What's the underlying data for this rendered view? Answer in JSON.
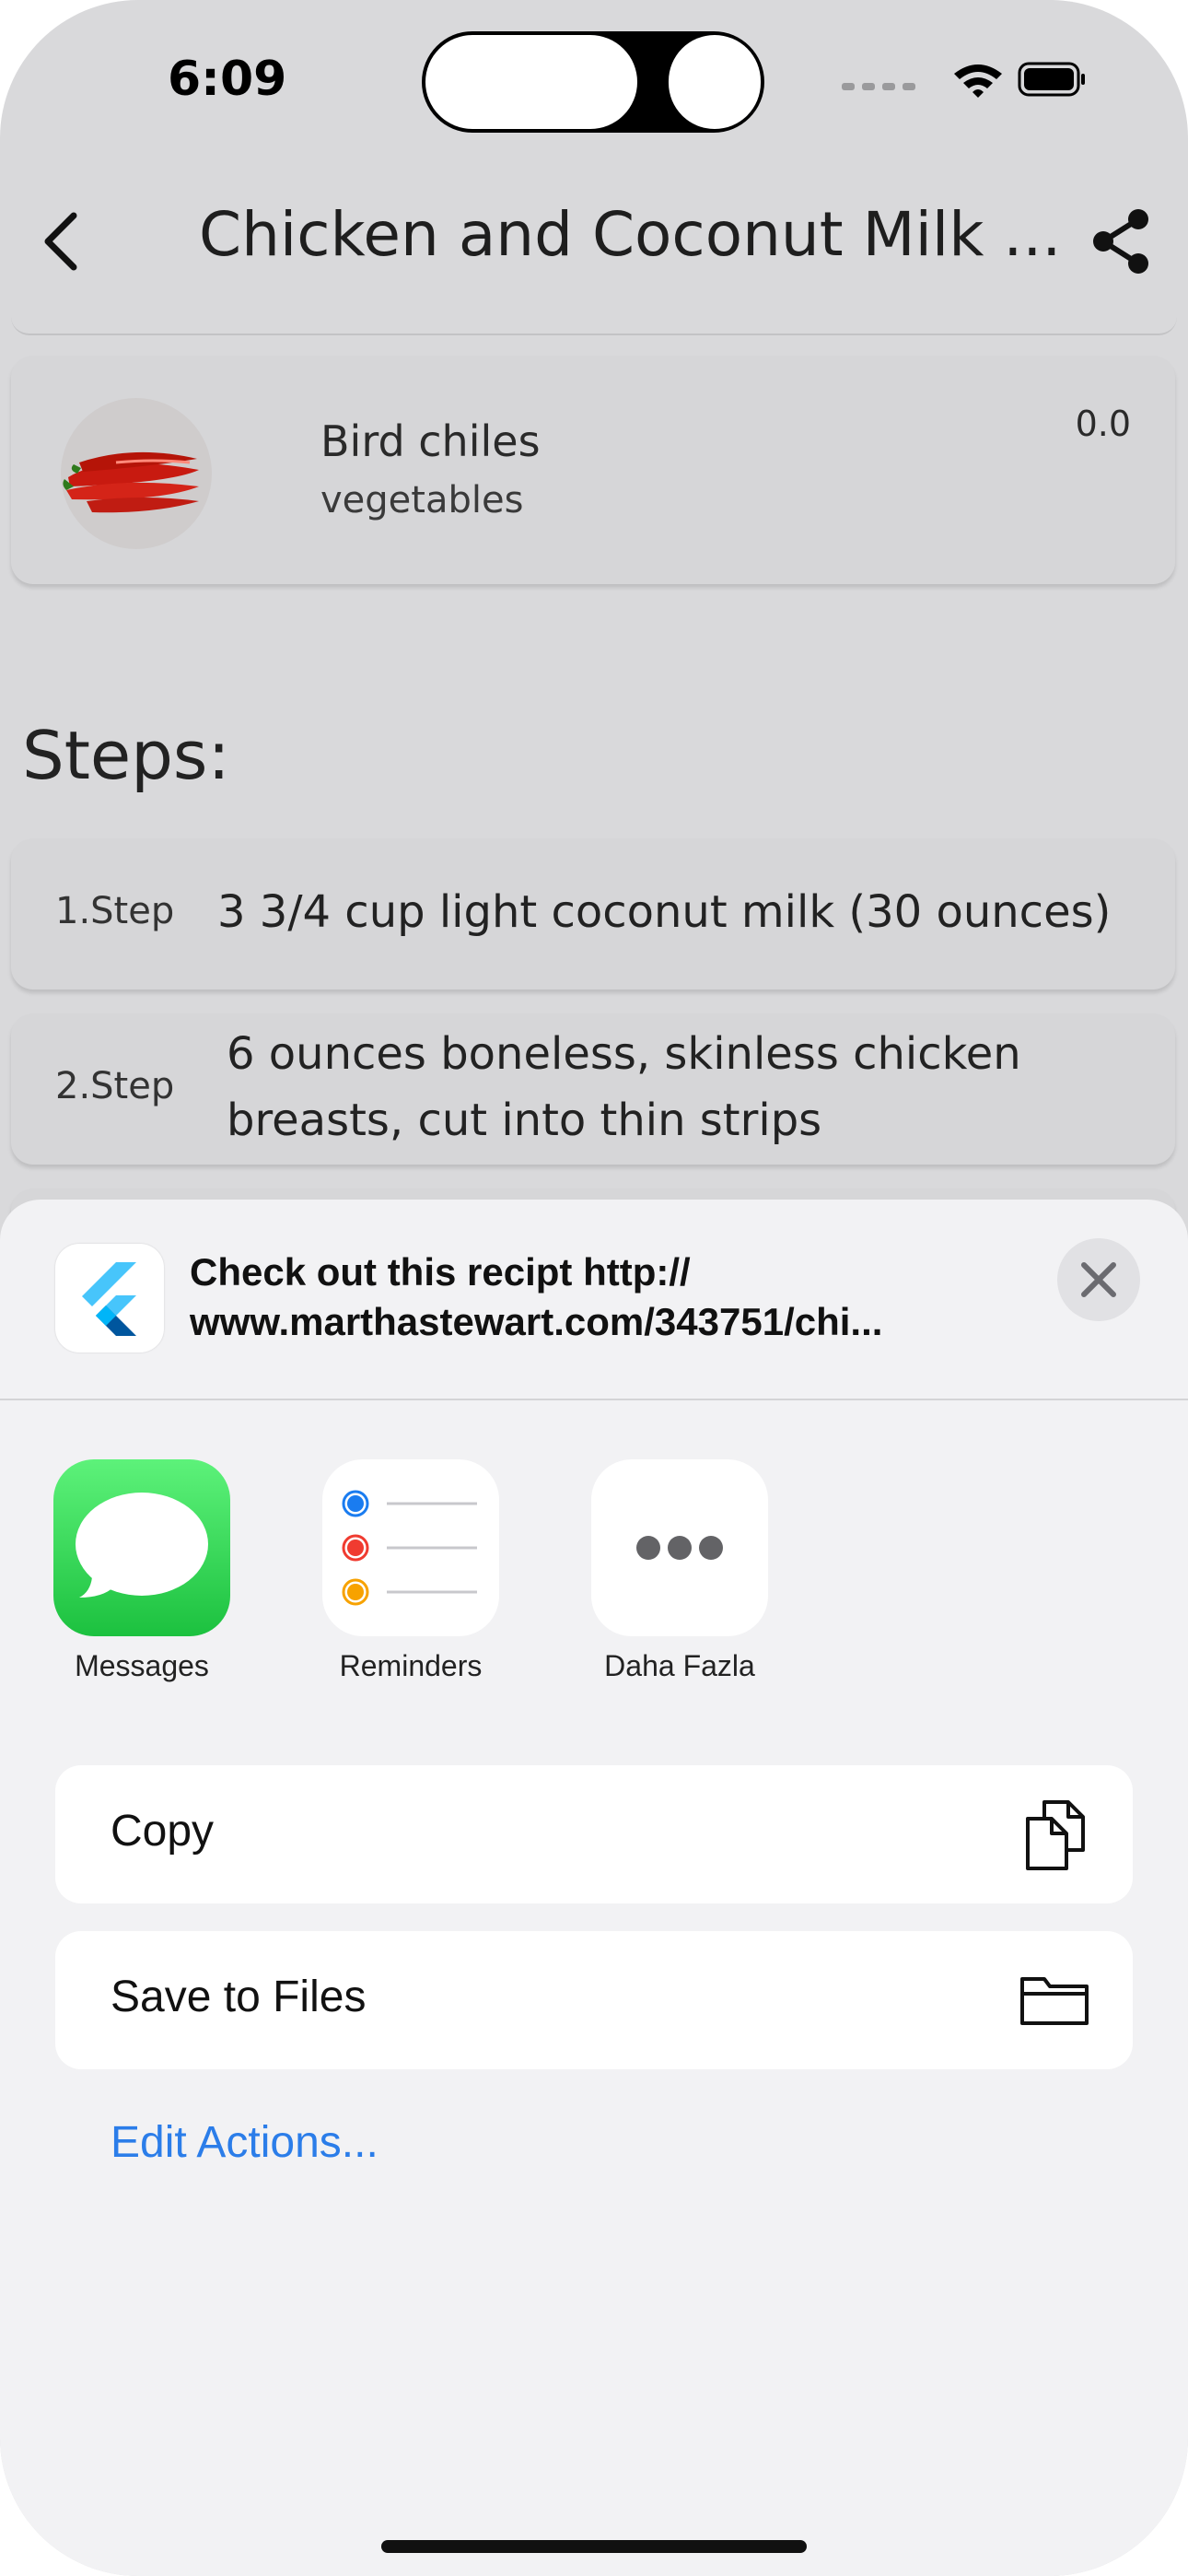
{
  "status_bar": {
    "time": "6:09"
  },
  "app_bar": {
    "title": "Chicken and Coconut Milk ..."
  },
  "ingredient": {
    "name": "Bird chiles",
    "category": "vegetables",
    "quantity": "0.0"
  },
  "steps_heading": "Steps:",
  "steps": [
    {
      "number": "1.Step",
      "text": "3 3/4 cup light coconut milk (30 ounces)"
    },
    {
      "number": "2.Step",
      "text_line1": "6 ounces boneless, skinless chicken",
      "text_line2": "breasts, cut into thin strips"
    }
  ],
  "share_sheet": {
    "message_line1": "Check out this recipt http://",
    "message_line2": "www.marthastewart.com/343751/chi...",
    "targets": [
      {
        "label": "Messages",
        "icon": "messages-icon"
      },
      {
        "label": "Reminders",
        "icon": "reminders-icon"
      },
      {
        "label": "Daha Fazla",
        "icon": "more-icon"
      }
    ],
    "actions": [
      {
        "label": "Copy",
        "icon": "copy-icon"
      },
      {
        "label": "Save to Files",
        "icon": "folder-icon"
      }
    ],
    "edit_actions": "Edit Actions..."
  },
  "colors": {
    "link": "#2b7de9",
    "messages_green": "#34c759",
    "reminder_blue": "#1a7cf0",
    "reminder_red": "#f03b30",
    "reminder_orange": "#f7a200"
  }
}
